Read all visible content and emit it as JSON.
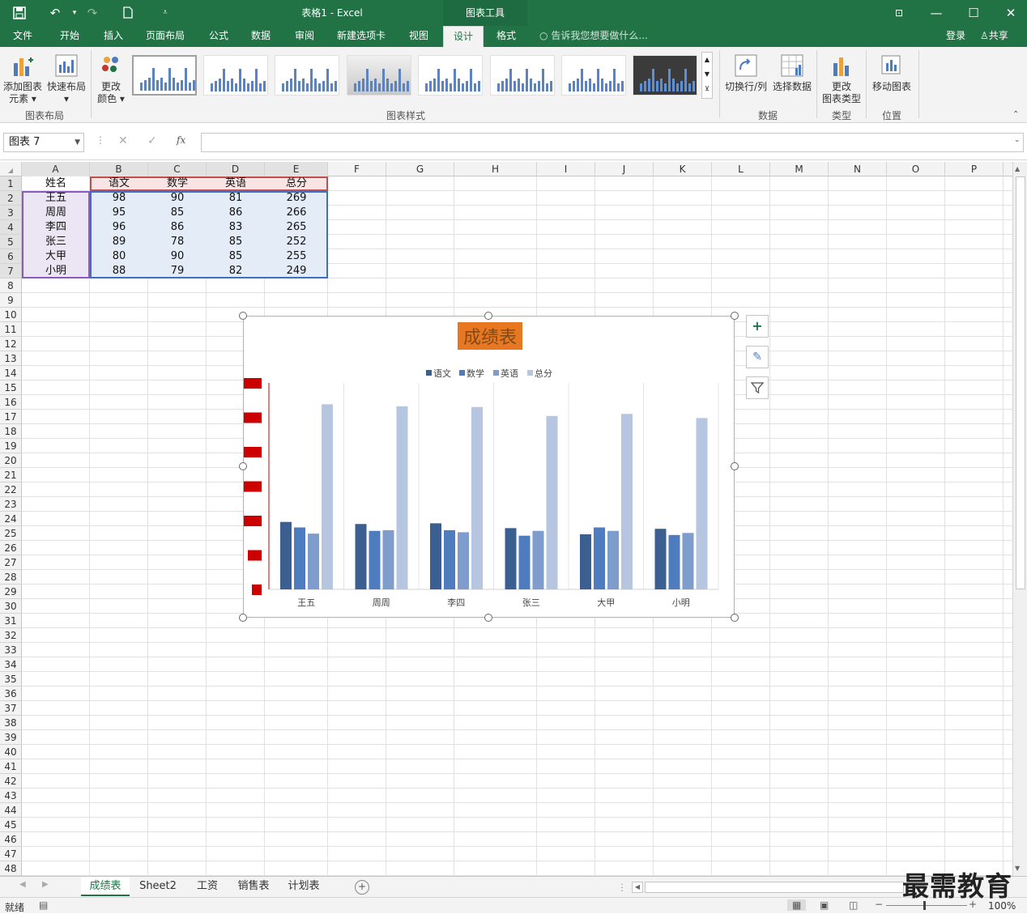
{
  "window": {
    "title": "表格1 - Excel",
    "context_header": "图表工具",
    "login": "登录",
    "share": "共享"
  },
  "tabs": [
    "文件",
    "开始",
    "插入",
    "页面布局",
    "公式",
    "数据",
    "审阅",
    "新建选项卡",
    "视图",
    "设计",
    "格式"
  ],
  "active_tab": "设计",
  "search_hint": "告诉我您想要做什么...",
  "ribbon": {
    "add_element": [
      "添加图表",
      "元素"
    ],
    "quick_layout": "快速布局",
    "change_color": [
      "更改",
      "颜色"
    ],
    "group_layout": "图表布局",
    "group_styles": "图表样式",
    "switch_rowcol": "切换行/列",
    "select_data": "选择数据",
    "group_data": "数据",
    "change_type": [
      "更改",
      "图表类型"
    ],
    "group_type": "类型",
    "move_chart": "移动图表",
    "group_location": "位置"
  },
  "formula_bar": {
    "name_box": "图表 7",
    "fx": "fx",
    "formula": ""
  },
  "columns": [
    "A",
    "B",
    "C",
    "D",
    "E",
    "F",
    "G",
    "H",
    "I",
    "J",
    "K",
    "L",
    "M",
    "N",
    "O",
    "P"
  ],
  "rows": [
    "1",
    "2",
    "3",
    "4",
    "5",
    "6",
    "7",
    "8",
    "9",
    "10",
    "11",
    "12",
    "13",
    "14",
    "15",
    "16",
    "17",
    "18",
    "19",
    "20",
    "21",
    "22",
    "23",
    "24",
    "25",
    "26",
    "27",
    "28",
    "29",
    "30",
    "31",
    "32",
    "33",
    "34",
    "35",
    "36",
    "37",
    "38",
    "39",
    "40",
    "41",
    "42",
    "43",
    "44",
    "45",
    "46",
    "47",
    "48"
  ],
  "table": {
    "headers": [
      "姓名",
      "语文",
      "数学",
      "英语",
      "总分"
    ],
    "rows": [
      [
        "王五",
        "98",
        "90",
        "81",
        "269"
      ],
      [
        "周周",
        "95",
        "85",
        "86",
        "266"
      ],
      [
        "李四",
        "96",
        "86",
        "83",
        "265"
      ],
      [
        "张三",
        "89",
        "78",
        "85",
        "252"
      ],
      [
        "大甲",
        "80",
        "90",
        "85",
        "255"
      ],
      [
        "小明",
        "88",
        "79",
        "82",
        "249"
      ]
    ]
  },
  "chart_data": {
    "type": "bar",
    "title": "成绩表",
    "categories": [
      "王五",
      "周周",
      "李四",
      "张三",
      "大甲",
      "小明"
    ],
    "series": [
      {
        "name": "语文",
        "values": [
          98,
          95,
          96,
          89,
          80,
          88
        ]
      },
      {
        "name": "数学",
        "values": [
          90,
          85,
          86,
          78,
          90,
          79
        ]
      },
      {
        "name": "英语",
        "values": [
          81,
          86,
          83,
          85,
          85,
          82
        ]
      },
      {
        "name": "总分",
        "values": [
          269,
          266,
          265,
          252,
          255,
          249
        ]
      }
    ],
    "ylim": [
      0,
      300
    ],
    "grid": true,
    "legend": "top",
    "colors": [
      "#3c5f91",
      "#4f7bbf",
      "#7f9dcc",
      "#b6c5e0"
    ],
    "title_bg": "#e87722",
    "ytick_label_bg": "#cc0000"
  },
  "sheet_tabs": [
    "成绩表",
    "Sheet2",
    "工资",
    "销售表",
    "计划表"
  ],
  "active_sheet": "成绩表",
  "status": {
    "ready": "就绪",
    "zoom": "100%"
  },
  "watermark": "最需教育"
}
